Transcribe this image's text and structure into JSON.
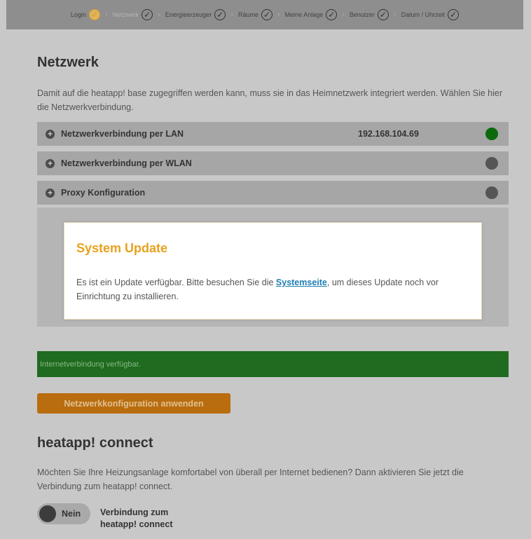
{
  "steps": [
    {
      "label": "Login"
    },
    {
      "label": "Netzwerk"
    },
    {
      "label": "Energieerzeuger"
    },
    {
      "label": "Räume"
    },
    {
      "label": "Meine Anlage"
    },
    {
      "label": "Benutzer"
    },
    {
      "label": "Datum / Uhrzeit"
    }
  ],
  "network": {
    "title": "Netzwerk",
    "intro": "Damit auf die heatapp! base zugegriffen werden kann, muss sie in das Heimnetzwerk integriert werden. Wählen Sie hier die Netzwerkverbindung.",
    "sections": [
      {
        "label": "Netzwerkverbindung per LAN",
        "value": "192.168.104.69",
        "status_color": "#0b6b0b"
      },
      {
        "label": "Netzwerkverbindung per WLAN",
        "value": "",
        "status_color": "#555555"
      },
      {
        "label": "Proxy Konfiguration",
        "value": "",
        "status_color": "#555555"
      }
    ],
    "status_message": "Internetverbindung verfügbar.",
    "apply_button": "Netzwerkkonfiguration anwenden"
  },
  "modal": {
    "title": "System Update",
    "text_before": "Es ist ein Update verfügbar. Bitte besuchen Sie die ",
    "link": "Systemseite",
    "text_after": ", um dieses Update noch vor Einrichtung zu installieren."
  },
  "connect": {
    "title": "heatapp! connect",
    "intro": "Möchten Sie Ihre Heizungsanlage komfortabel von überall per Internet bedienen? Dann aktivieren Sie jetzt die Verbindung zum heatapp! connect.",
    "toggle_label": "Nein",
    "toggle_desc": "Verbindung zum heatapp! connect"
  },
  "colors": {
    "accent_orange": "#e8a21e",
    "button_orange": "#b96d0f",
    "status_green": "#1f6b1f",
    "link_blue": "#1f7fb3"
  }
}
